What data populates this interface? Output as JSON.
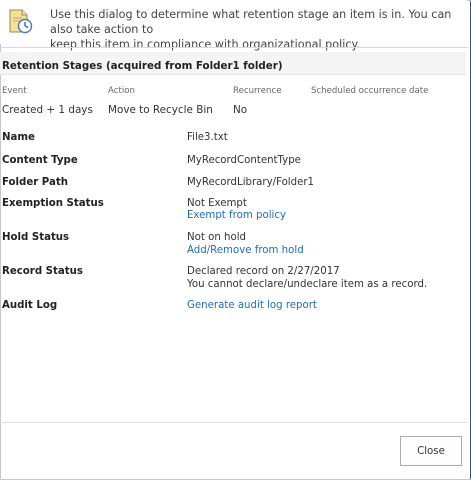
{
  "intro": {
    "line1": "Use this dialog to determine what retention stage an item is in. You can also take action to",
    "line2": "keep this item in compliance with organizational policy."
  },
  "retention": {
    "title": "Retention Stages (acquired from Folder1 folder)",
    "columns": [
      "Event",
      "Action",
      "Recurrence",
      "Scheduled occurrence date"
    ],
    "rows": [
      {
        "event": "Created + 1 days",
        "action": "Move to Recycle Bin",
        "recurrence": "No",
        "scheduled": ""
      }
    ]
  },
  "properties": {
    "name": {
      "label": "Name",
      "value": "File3.txt"
    },
    "content_type": {
      "label": "Content Type",
      "value": "MyRecordContentType"
    },
    "folder_path": {
      "label": "Folder Path",
      "value": "MyRecordLibrary/Folder1"
    },
    "exemption_status": {
      "label": "Exemption Status",
      "value": "Not Exempt",
      "link": "Exempt from policy"
    },
    "hold_status": {
      "label": "Hold Status",
      "value": "Not on hold",
      "link": "Add/Remove from hold"
    },
    "record_status": {
      "label": "Record Status",
      "value": "Declared record on 2/27/2017",
      "note": "You cannot declare/undeclare item as a record."
    },
    "audit_log": {
      "label": "Audit Log",
      "link": "Generate audit log report"
    }
  },
  "footer": {
    "close_label": "Close"
  },
  "icons": {
    "intro": "document-clock-icon"
  },
  "colors": {
    "link": "#1f6cbf",
    "accent_border": "#2b579a",
    "icon_fill": "#f5e29a"
  }
}
